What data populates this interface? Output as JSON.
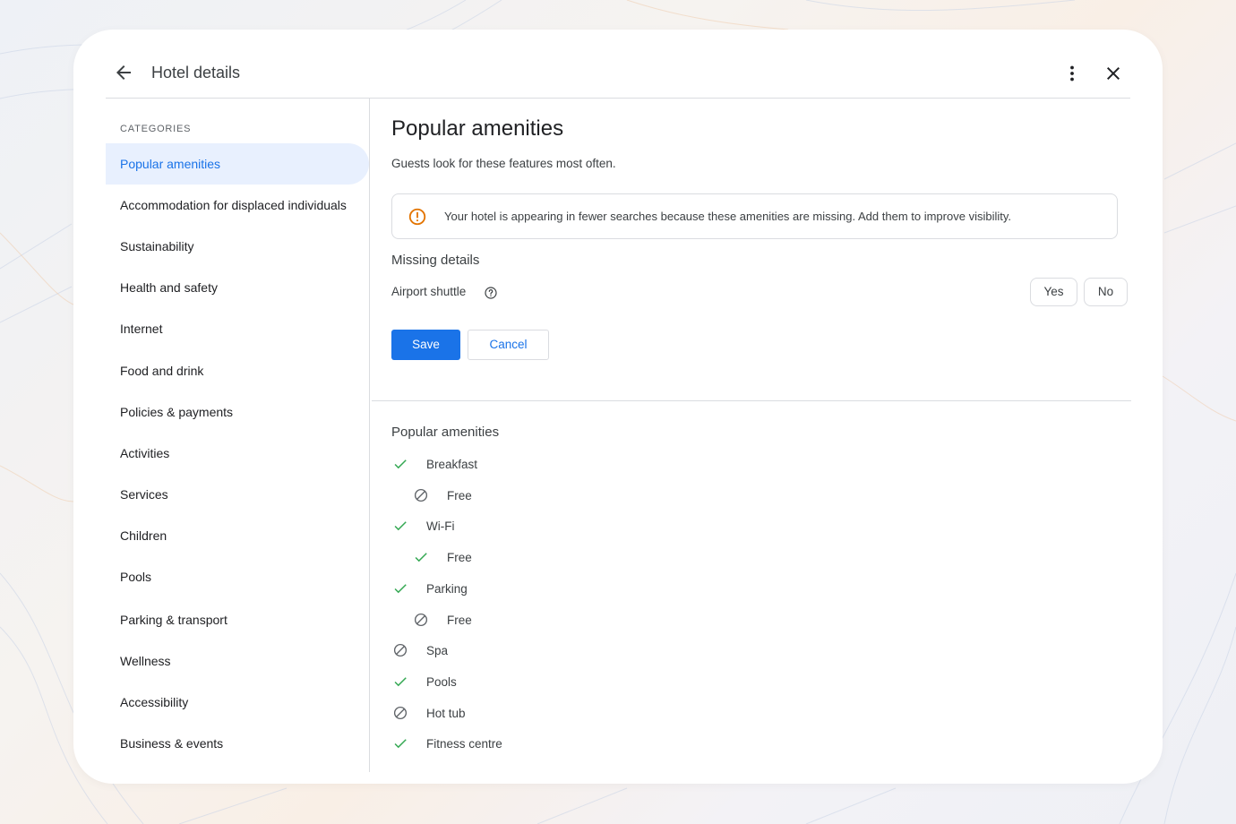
{
  "header": {
    "title": "Hotel details",
    "back_icon": "arrow-back-icon",
    "more_icon": "more-vert-icon",
    "close_icon": "close-icon"
  },
  "sidebar": {
    "heading": "CATEGORIES",
    "items": [
      {
        "label": "Popular amenities",
        "active": true
      },
      {
        "label": "Accommodation for displaced individuals"
      },
      {
        "label": "Sustainability"
      },
      {
        "label": "Health and safety"
      },
      {
        "label": "Internet"
      },
      {
        "label": "Food and drink"
      },
      {
        "label": "Policies & payments"
      },
      {
        "label": "Activities"
      },
      {
        "label": "Services"
      },
      {
        "label": "Children"
      },
      {
        "label": "Pools"
      },
      {
        "label": "Parking & transport"
      },
      {
        "label": "Wellness"
      },
      {
        "label": "Accessibility"
      },
      {
        "label": "Business & events"
      }
    ]
  },
  "main": {
    "title": "Popular amenities",
    "subtitle": "Guests look for these features most often.",
    "alert": {
      "icon": "warning-circle-icon",
      "text": "Your hotel is appearing in fewer searches because these amenities are missing. Add them to improve visibility."
    },
    "missing": {
      "title": "Missing details",
      "field_label": "Airport shuttle",
      "help_icon": "help-circle-icon",
      "yes_label": "Yes",
      "no_label": "No"
    },
    "save_label": "Save",
    "cancel_label": "Cancel",
    "amenities": {
      "title": "Popular amenities",
      "items": [
        {
          "label": "Breakfast",
          "status": "yes",
          "level": 0
        },
        {
          "label": "Free",
          "status": "no",
          "level": 1
        },
        {
          "label": "Wi-Fi",
          "status": "yes",
          "level": 0
        },
        {
          "label": "Free",
          "status": "yes",
          "level": 1
        },
        {
          "label": "Parking",
          "status": "yes",
          "level": 0
        },
        {
          "label": "Free",
          "status": "no",
          "level": 1
        },
        {
          "label": "Spa",
          "status": "no",
          "level": 0
        },
        {
          "label": "Pools",
          "status": "yes",
          "level": 0
        },
        {
          "label": "Hot tub",
          "status": "no",
          "level": 0
        },
        {
          "label": "Fitness centre",
          "status": "yes",
          "level": 0
        }
      ]
    }
  },
  "colors": {
    "accent": "#1a73e8",
    "active_bg": "#e8f0fe",
    "check": "#34a853",
    "warning": "#e37400",
    "text": "#202124",
    "muted": "#5f6368"
  }
}
